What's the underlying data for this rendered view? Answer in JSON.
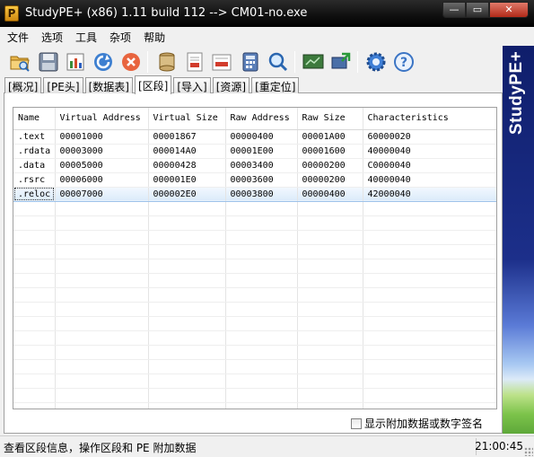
{
  "window": {
    "title": "StudyPE+ (x86) 1.11 build 112  --> CM01-no.exe",
    "app_icon_glyph": "P",
    "buttons": {
      "minimize": "—",
      "maximize": "▭",
      "close": "✕"
    }
  },
  "menu": [
    "文件",
    "选项",
    "工具",
    "杂项",
    "帮助"
  ],
  "toolbar": {
    "icons": [
      "open-folder-icon",
      "save-icon",
      "pe-chart-icon",
      "refresh-icon",
      "close-file-icon",
      "database-icon",
      "document-icon",
      "rva-converter-icon",
      "calculator-icon",
      "search-icon",
      "screen-icon",
      "export-icon",
      "settings-icon",
      "help-icon"
    ]
  },
  "banner": {
    "text": "StudyPE+"
  },
  "tabs": [
    "[概况]",
    "[PE头]",
    "[数据表]",
    "[区段]",
    "[导入]",
    "[资源]",
    "[重定位]"
  ],
  "active_tab": "[区段]",
  "sections_table": {
    "columns": [
      "Name",
      "Virtual Address",
      "Virtual Size",
      "Raw Address",
      "Raw Size",
      "Characteristics"
    ],
    "rows": [
      [
        ".text",
        "00001000",
        "00001867",
        "00000400",
        "00001A00",
        "60000020"
      ],
      [
        ".rdata",
        "00003000",
        "000014A0",
        "00001E00",
        "00001600",
        "40000040"
      ],
      [
        ".data",
        "00005000",
        "00000428",
        "00003400",
        "00000200",
        "C0000040"
      ],
      [
        ".rsrc",
        "00006000",
        "000001E0",
        "00003600",
        "00000200",
        "40000040"
      ],
      [
        ".reloc",
        "00007000",
        "000002E0",
        "00003800",
        "00000400",
        "42000040"
      ]
    ],
    "selected_row": 4
  },
  "checkbox": {
    "label": "显示附加数据或数字签名",
    "checked": false
  },
  "status": {
    "message": "查看区段信息，操作区段和 PE 附加数据",
    "time": "21:00:45"
  },
  "colors": {
    "banner_top": "#0f1e6b",
    "banner_bottom": "#5ea83a",
    "selection": "#dbeaf9"
  }
}
